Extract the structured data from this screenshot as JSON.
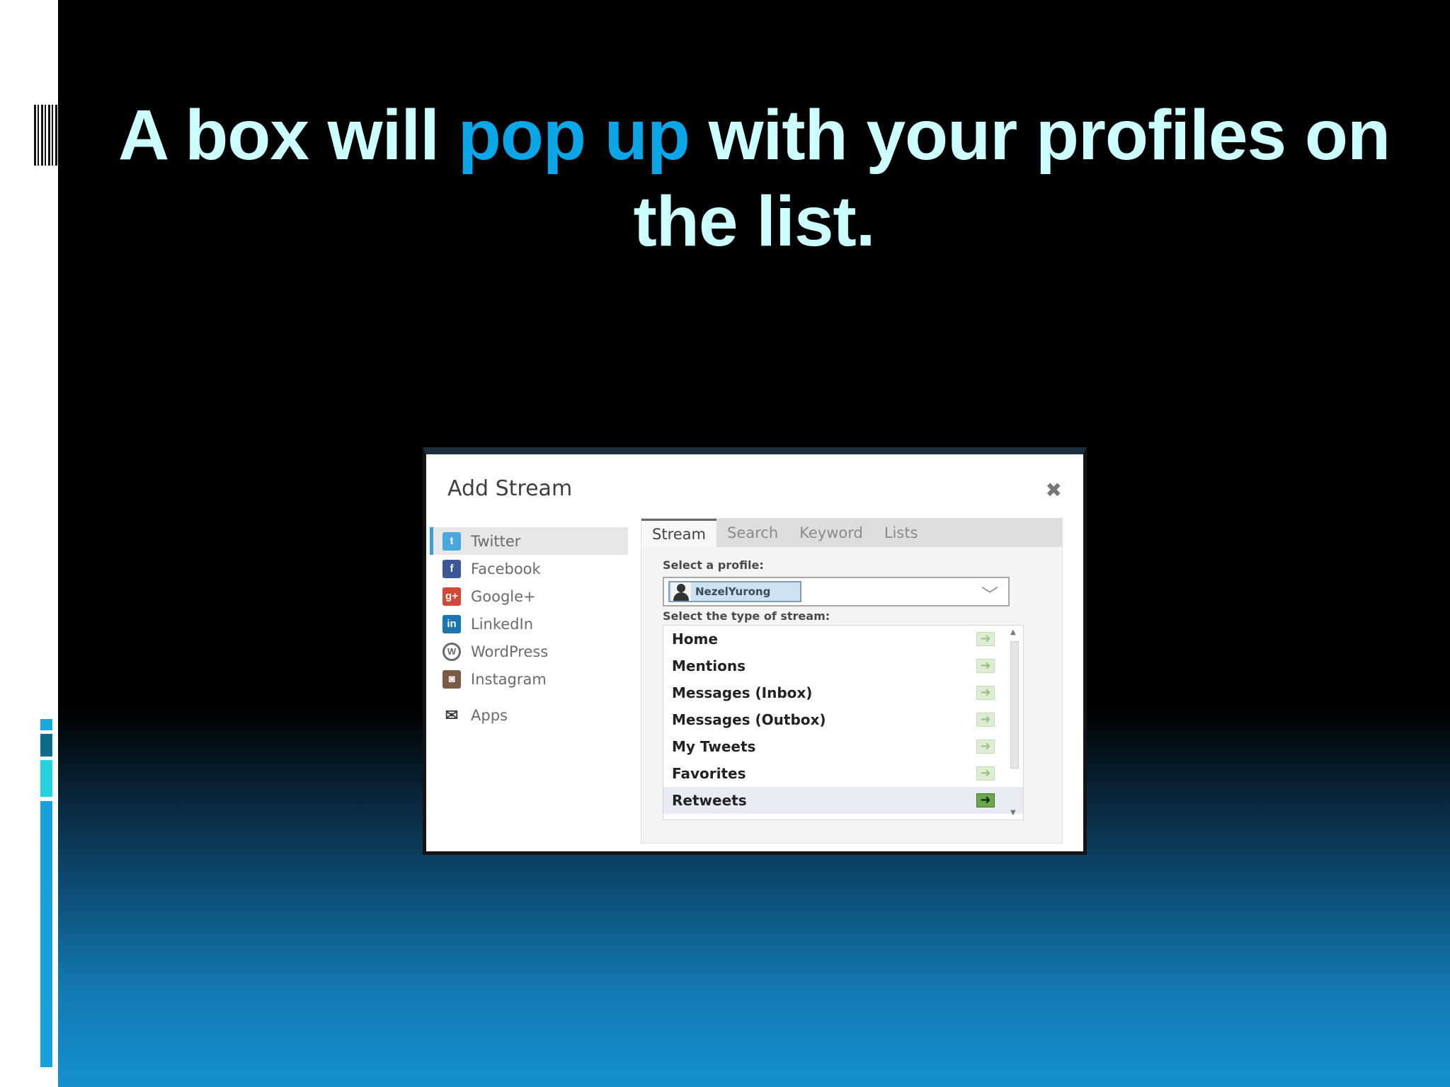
{
  "slide": {
    "title_pre": "A box will ",
    "title_highlight": "pop up",
    "title_post": " with your profiles on the list.",
    "highlight_color": "#0aa6e8",
    "title_color": "#ccffff"
  },
  "dialog": {
    "title": "Add Stream",
    "close_glyph": "✖",
    "networks": [
      {
        "label": "Twitter",
        "icon": "twitter-icon",
        "glyph": "t",
        "active": true
      },
      {
        "label": "Facebook",
        "icon": "facebook-icon",
        "glyph": "f"
      },
      {
        "label": "Google+",
        "icon": "google-plus-icon",
        "glyph": "g+"
      },
      {
        "label": "LinkedIn",
        "icon": "linkedin-icon",
        "glyph": "in"
      },
      {
        "label": "WordPress",
        "icon": "wordpress-icon",
        "glyph": "W"
      },
      {
        "label": "Instagram",
        "icon": "instagram-icon",
        "glyph": "◙"
      },
      {
        "label": "Apps",
        "icon": "apps-icon",
        "glyph": "✉"
      }
    ],
    "tabs": [
      {
        "label": "Stream",
        "active": true
      },
      {
        "label": "Search"
      },
      {
        "label": "Keyword"
      },
      {
        "label": "Lists"
      }
    ],
    "select_profile_label": "Select a profile:",
    "selected_profile": "NezelYurong",
    "select_type_label": "Select the type of stream:",
    "stream_types": [
      {
        "label": "Home"
      },
      {
        "label": "Mentions"
      },
      {
        "label": "Messages (Inbox)"
      },
      {
        "label": "Messages (Outbox)"
      },
      {
        "label": "My Tweets"
      },
      {
        "label": "Favorites"
      },
      {
        "label": "Retweets",
        "selected": true
      }
    ],
    "add_glyph": "➜"
  }
}
